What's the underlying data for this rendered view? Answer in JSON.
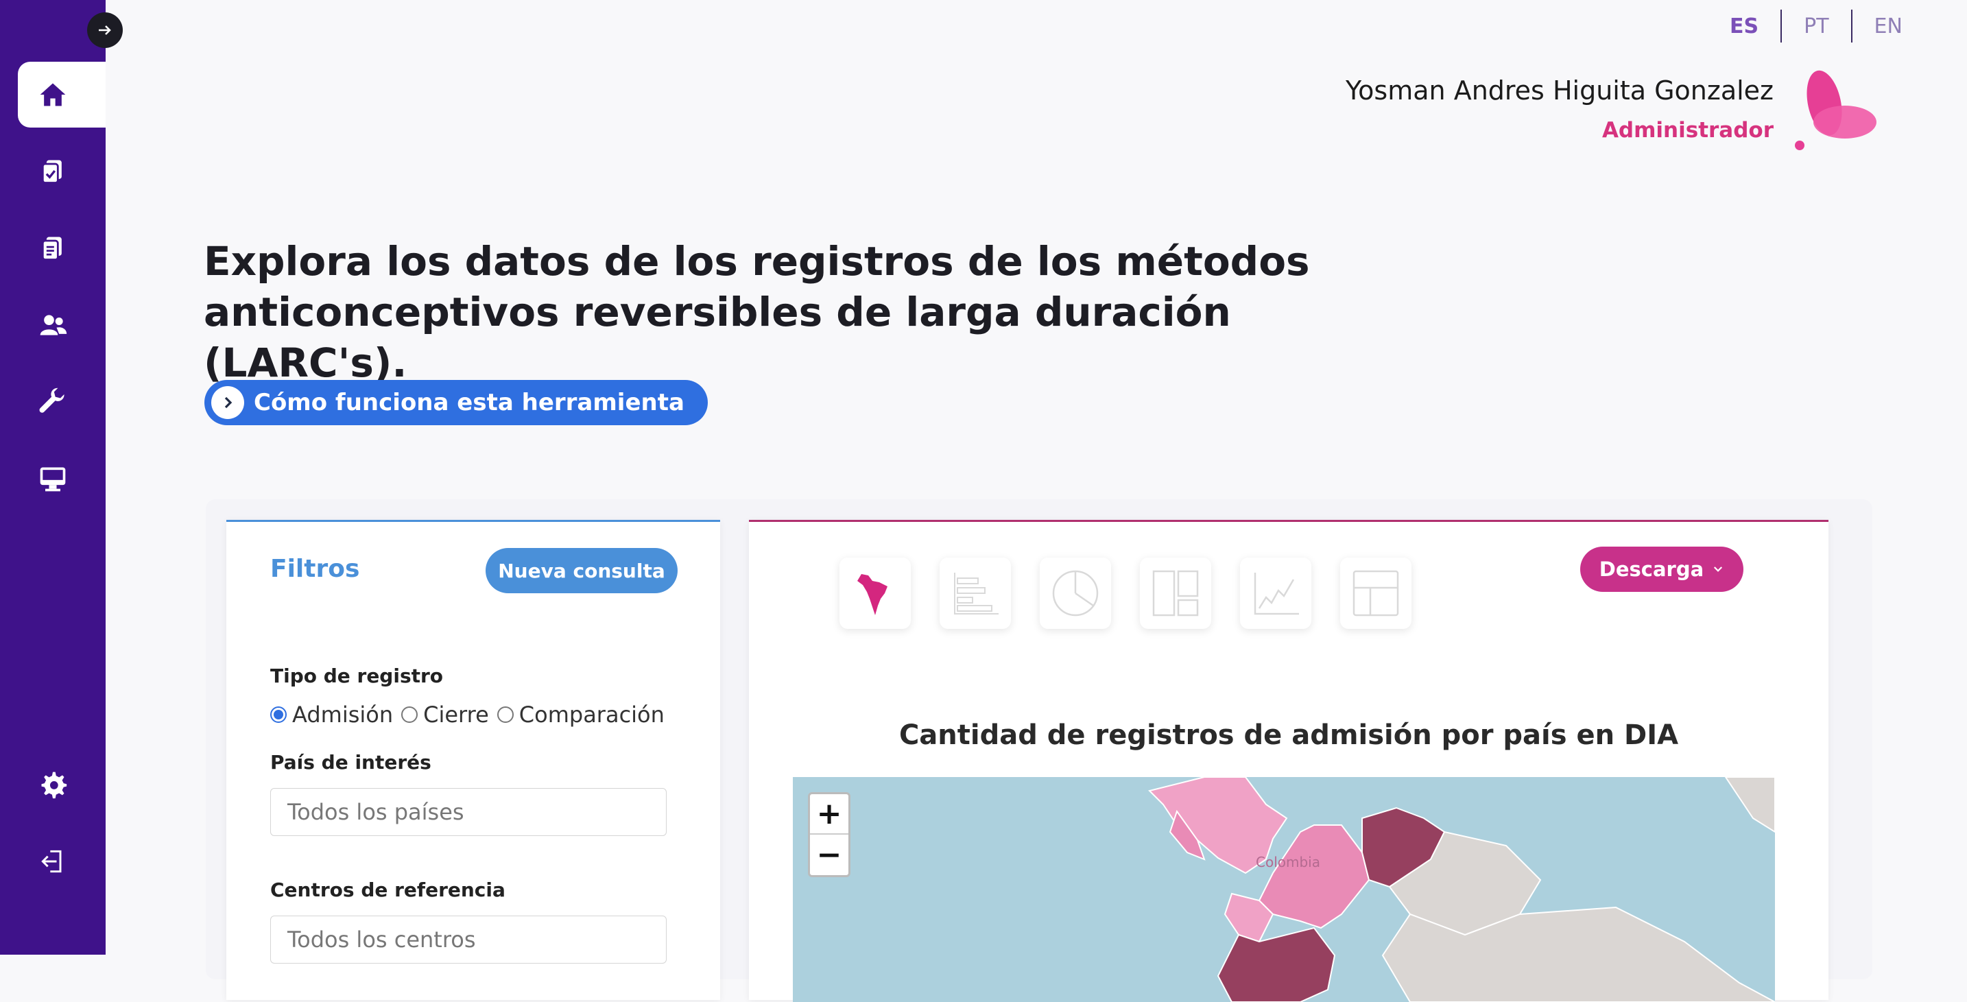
{
  "sidebar": {
    "collapse_icon": "arrow-right-icon",
    "items": [
      {
        "icon": "home-icon",
        "active": true
      },
      {
        "icon": "clipboard-check-icon"
      },
      {
        "icon": "clipboard-list-icon"
      },
      {
        "icon": "users-icon"
      },
      {
        "icon": "wrench-icon"
      },
      {
        "icon": "desktop-icon"
      }
    ],
    "bottom": [
      {
        "icon": "gear-icon"
      },
      {
        "icon": "logout-icon"
      }
    ]
  },
  "header": {
    "languages": [
      {
        "label": "ES",
        "active": true
      },
      {
        "label": "PT"
      },
      {
        "label": "EN"
      }
    ],
    "user_name": "Yosman Andres Higuita Gonzalez",
    "user_role": "Administrador"
  },
  "hero": {
    "line1": "Explora los datos de los registros de los métodos",
    "line2": "anticonceptivos reversibles de larga duración (LARC's).",
    "how_button": "Cómo funciona esta herramienta"
  },
  "filters": {
    "title": "Filtros",
    "new_query": "Nueva consulta",
    "register_type_label": "Tipo de registro",
    "register_options": [
      "Admisión",
      "Cierre",
      "Comparación"
    ],
    "selected_option": "Admisión",
    "country_label": "País de interés",
    "country_placeholder": "Todos los países",
    "centers_label": "Centros de referencia",
    "centers_placeholder": "Todos los centros"
  },
  "chart_panel": {
    "viz_buttons": [
      "map-icon",
      "bar-chart-icon",
      "pie-chart-icon",
      "treemap-icon",
      "line-chart-icon",
      "table-icon"
    ],
    "download": "Descarga",
    "title": "Cantidad de registros de admisión por país en DIA",
    "map": {
      "zoom_in": "+",
      "zoom_out": "−",
      "label": "Colombia"
    }
  },
  "colors": {
    "sidebar": "#3f128a",
    "primary_blue": "#4a90d9",
    "button_blue": "#2f6fe0",
    "magenta": "#c8318a",
    "role_pink": "#d6337e"
  }
}
